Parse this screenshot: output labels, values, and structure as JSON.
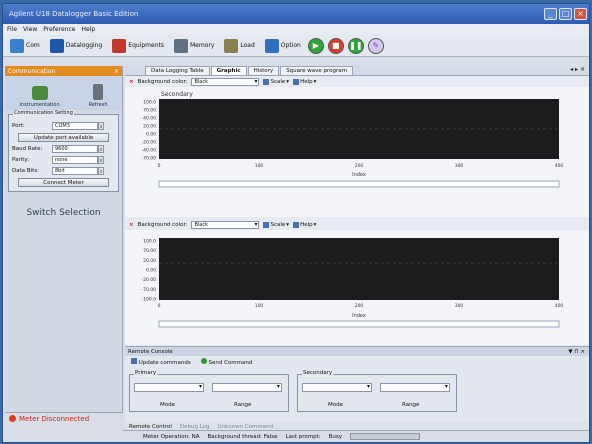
{
  "window": {
    "title": "Agilent U18 Datalogger Basic Edition"
  },
  "menu": [
    "File",
    "View",
    "Preference",
    "Help"
  ],
  "toolbar": {
    "items": [
      {
        "label": "Com",
        "color": "#3a7fd0"
      },
      {
        "label": "Datalogging",
        "color": "#1e58a8"
      },
      {
        "label": "Equipments",
        "color": "#c0392b"
      },
      {
        "label": "Memory",
        "color": "#607080"
      },
      {
        "label": "Load",
        "color": "#8a7f50"
      },
      {
        "label": "Option",
        "color": "#2f6fc0"
      }
    ],
    "controls": [
      "play-icon",
      "stop-icon",
      "pause-icon",
      "eraser-icon"
    ]
  },
  "left_panel": {
    "header": "Communication",
    "close": "×",
    "icons": [
      "Instrumentation",
      "Refresh"
    ],
    "settings_title": "Communication Setting",
    "fields": [
      {
        "label": "Port:",
        "value": "COM3"
      },
      {
        "label": "Baud Rate:",
        "value": "9600"
      },
      {
        "label": "Parity:",
        "value": "none"
      },
      {
        "label": "Data Bits:",
        "value": "8bit"
      }
    ],
    "update_button": "Update port available",
    "connect_button": "Connect Meter",
    "switch_title": "Switch Selection",
    "meter_status": "Meter Disconnected"
  },
  "tabs": [
    "Data Logging Table",
    "Graphic",
    "History",
    "Square wave program"
  ],
  "active_tab": "Graphic",
  "chart_toolbar": {
    "bg_label": "Background color:",
    "bg_value": "Black",
    "scale_label": "Scale",
    "help_label": "Help"
  },
  "chart1": {
    "label": "Secondary",
    "y_ticks": [
      "100.0",
      "70.00",
      "40.00",
      "20.00",
      "0.00",
      "-20.00",
      "-40.00",
      "-70.00"
    ],
    "x_ticks": [
      "0",
      "100",
      "200",
      "300",
      "400"
    ],
    "xlabel": "Index"
  },
  "chart2": {
    "y_ticks": [
      "100.0",
      "70.00",
      "20.00",
      "0.00",
      "-20.00",
      "-70.00",
      "-100.0"
    ],
    "x_ticks": [
      "0",
      "100",
      "200",
      "300",
      "400"
    ],
    "xlabel": "Index"
  },
  "remote": {
    "header": "Remote Console",
    "ctrl": "▼ ⊓ ×",
    "update_commands": "Update commands",
    "send_command": "Send Command",
    "primary": "Primary",
    "secondary": "Secondary",
    "mode": "Mode",
    "range": "Range",
    "bottom_tabs": [
      "Remote Control",
      "Debug Log",
      "Unknown Command"
    ]
  },
  "status": {
    "meter_operation": "Meter Operation: NA",
    "background_thread": "Background thread: False",
    "last_prompt": "Last prompt:",
    "busy": "Busy"
  }
}
